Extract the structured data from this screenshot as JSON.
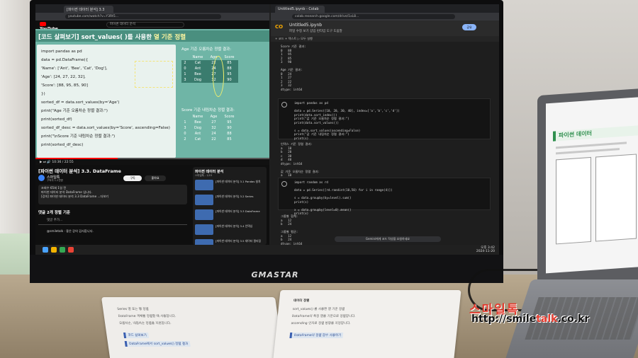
{
  "watermark": {
    "name": "스마일톡",
    "url_prefix": "http://smile",
    "url_accent": "talk",
    "url_suffix": ".co.kr"
  },
  "monitor": {
    "brand": "GMASTAR"
  },
  "youtube": {
    "tab_title": "[파이썬 데이터 분석] 3.3",
    "address": "youtube.com/watch?v=Y3Rt5...",
    "logo": "YouTube",
    "search_placeholder": "파이썬 데이터 분석",
    "slide": {
      "title_prefix": "[코드 살펴보기] sort_values( )를 사용한 ",
      "title_highlight": "열 기준 정렬",
      "code_lines": [
        "import pandas as pd",
        "data = pd.DataFrame({",
        "  'Name': ['Ant', 'Bee', 'Cat', 'Dog'],",
        "  'Age': [24, 27, 22, 32],",
        "  'Score': [88, 95, 85, 90]",
        "})",
        "sorted_df = data.sort_values(by='Age')",
        "print(\"Age 기준 오름차순 정렬 결과:\")",
        "print(sorted_df)",
        "sorted_df_desc = data.sort_values(by='Score', ascending=False)",
        "print(\"\\nScore 기준 내림차순 정렬 결과:\")",
        "print(sorted_df_desc)"
      ],
      "result_title": "Age 기준 오름차순 정렬 결과:",
      "result_header": [
        "",
        "Name",
        "Age",
        "Score"
      ],
      "result_rows": [
        [
          "2",
          "Cat",
          "22",
          "85"
        ],
        [
          "0",
          "Ant",
          "24",
          "88"
        ],
        [
          "1",
          "Bee",
          "27",
          "95"
        ],
        [
          "3",
          "Dog",
          "32",
          "90"
        ]
      ],
      "sorted_title": "Score 기준 내림차순 정렬 결과:",
      "sorted_header": [
        "",
        "Name",
        "Age",
        "Score"
      ],
      "sorted_rows": [
        [
          "1",
          "Bee",
          "27",
          "95"
        ],
        [
          "3",
          "Dog",
          "32",
          "90"
        ],
        [
          "0",
          "Ant",
          "24",
          "88"
        ],
        [
          "2",
          "Cat",
          "22",
          "85"
        ]
      ]
    },
    "progress_fraction": 0.35,
    "time_display": "10:36 / 22:55",
    "video_title": "[파이썬 데이터 분석] 3.3. DataFrame",
    "channel_name": "스마일톡",
    "channel_subs": "구독자 1.2천명",
    "subscribe_label": "구독",
    "like_label": "좋아요",
    "description_lines": [
      "조회수 65회  1일 전",
      "파이썬 데이터 분석 DataFrame 입니다.",
      "[강의] 파이썬 데이터 분석 3.3 DataFrame ...더보기"
    ],
    "comments_label": "댓글 2개   정렬 기준",
    "comment_placeholder": "댓글 추가...",
    "comment_text": "@smiletalk · 좋은 강의 감사합니다.",
    "playlist": {
      "title": "파이썬 데이터 분석",
      "subtitle": "스마일톡 - 1/15",
      "items": [
        "[파이썬 데이터 분석] 3.1 Pandas 설치",
        "[파이썬 데이터 분석] 3.2 Series",
        "[파이썬 데이터 분석] 3.3 DataFrame",
        "[파이썬 데이터 분석] 3.4 인덱싱",
        "[파이썬 데이터 분석] 3.5 데이터 필터링"
      ]
    }
  },
  "colab": {
    "tab_title": "Untitled5.ipynb - Colab",
    "address": "colab.research.google.com/drive/1xL8...",
    "logo": "CO",
    "file_name": "Untitled5.ipynb",
    "menu": "파일  수정  보기  삽입  런타임  도구  도움말",
    "share_label": "공유",
    "toolbar": "+ 코드  + 텍스트  ▷ 모두 실행",
    "output_top": "Score 기준 결과:\n0   88\n1   95\n2   85\n3   90\n\nAge 기준 결과:\n0   24\n1   27\n2   22\n3   32\ndtype: int64",
    "cell1": "import pandas as pd\n\ndata = pd.Series([10, 20, 30, 40], index=['a','b','c','d'])\nprint(data.sort_index())\nprint(\"값 기준 오름차순 정렬 결과:\")\nprint(data.sort_values())\n\ns = data.sort_values(ascending=False)\nprint(\"값 기준 내림차순 정렬 결과:\")\nprint(s)",
    "output_mid": "인덱스 기준 정렬 결과:\na   10\nb   20\nc   30\nd   40\ndtype: int64\n\n값 기준 오름차순 정렬 결과:\na   10\nb   20\nc   30\nd   40",
    "cell2": "import random as rd\n\ndata = pd.Series([rd.randint(10,50) for i in range(4)])\n\ns = data.groupby(by=level).sum()\nprint(s)\n\nx = data.groupby(level=0).mean()\nprint(x)",
    "output_bottom": "그룹별 합계:\na   12\nb   24\n\n그룹별 평균:\na   12\nb   24\ndtype: int64",
    "gemini_prompt": "Gemini에게 코드 작성을 요청하세요"
  },
  "taskbar": {
    "time": "오후 3:42",
    "date": "2024-11-20"
  },
  "book": {
    "left_lines": [
      "Series 열 또는 행 정렬",
      "DataFrame 객체를 정렬할 때 사용합니다.",
      "오름차순, 내림차순 정렬을 지원합니다."
    ],
    "left_box": "코드 살펴보기",
    "left_box2": "DataFrame에서 sort_values() 정렬 결과",
    "right_heading": "데이터 정렬",
    "right_lines": [
      "sort_values() 를 사용한 열 기준 정렬",
      "DataFrame의 특정 열을 기준으로 정렬합니다.",
      "ascending 인자로 정렬 방향을 지정합니다."
    ],
    "right_box": "DataFrame의 정렬 함수 사용하기"
  },
  "laptop": {
    "title": "파이썬 데이터"
  }
}
